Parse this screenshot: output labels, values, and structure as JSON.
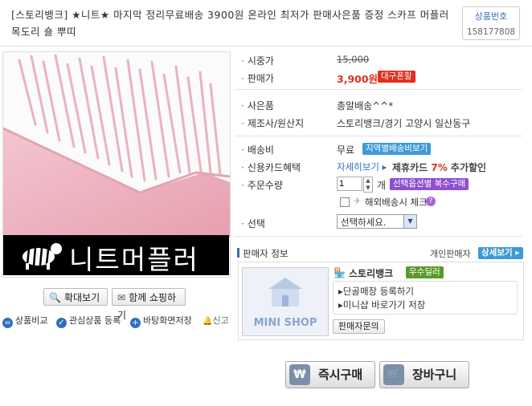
{
  "title": "[스토리뱅크] ★니트★ 마지막 정리무료배송 3900원 온라인 최저가 판매사은품 증정 스카프 머플러 목도리 숄 뿌띠",
  "product_code": {
    "label": "상품번호",
    "value": "158177808"
  },
  "image": {
    "banner_text": "니트머플러"
  },
  "image_buttons": {
    "zoom": "확대보기",
    "shop_together": "함께 쇼핑하기"
  },
  "actions": {
    "compare": "상품비교",
    "wishlist": "관심상품 등록",
    "desktop": "바탕화면저장",
    "report": "신고"
  },
  "price": {
    "list_label": "시중가",
    "list_value": "15,000",
    "sale_label": "판매가",
    "sale_value": "3,900원",
    "sale_badge": "대구폰할"
  },
  "info": {
    "gift_label": "사은품",
    "gift_value": "총알배송^^*",
    "maker_label": "제조사/원산지",
    "maker_value": "스토리뱅크/경기 고양시 일산동구"
  },
  "shipping": {
    "fee_label": "배송비",
    "fee_value": "무료",
    "fee_badge": "지역별배송비보기",
    "card_label": "신용카드혜택",
    "card_link": "자세히보기 ▸",
    "card_text": "제휴카드",
    "card_pct": "7%",
    "card_suffix": "추가할인",
    "qty_label": "주문수량",
    "qty_value": "1",
    "qty_unit": "개",
    "qty_badge": "선택옵션별 복수구매",
    "overseas": "해외배송시 체크",
    "option_label": "선택",
    "option_value": "선택하세요."
  },
  "seller": {
    "header": "판매자 정보",
    "type": "개인판매자",
    "detail_button": "상세보기 ▸",
    "name": "스토리뱅크",
    "grade": "우수딜러",
    "link1": "단골매장 등록하기",
    "link2": "미니샵 바로가기 저장",
    "mini_shop": "MINI SHOP",
    "contact": "판매자문의"
  },
  "buy_buttons": {
    "buy_now": "즉시구매",
    "cart": "장바구니"
  },
  "colors": {
    "price_red": "#e0301e",
    "badge_blue": "#3d9bd6",
    "badge_purple": "#8f4fd0",
    "seller_green": "#5a9a2a"
  }
}
